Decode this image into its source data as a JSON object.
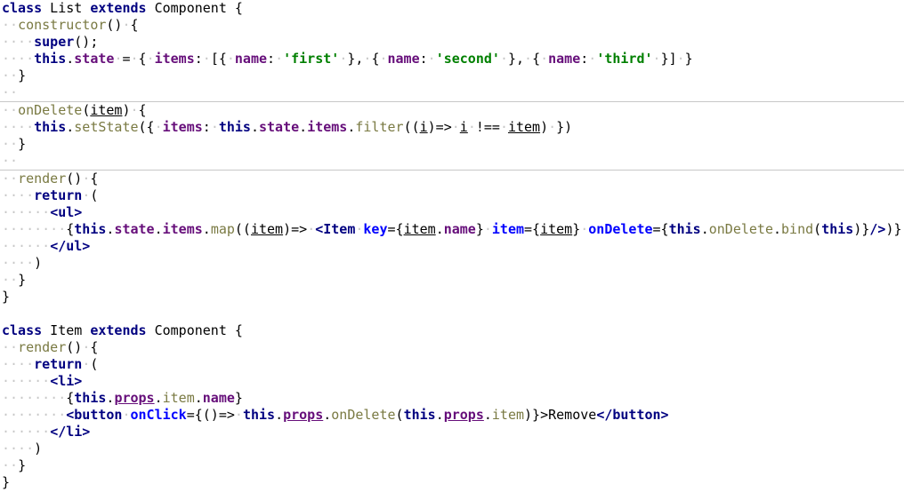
{
  "editor": {
    "lines": [
      "class List extends Component {",
      "  constructor() {",
      "    super();",
      "    this.state = { items: [{ name: 'first' }, { name: 'second' }, { name: 'third' }] }",
      "  }",
      "",
      "  onDelete(item) {",
      "    this.setState({ items: this.state.items.filter((i)=> i !== item) })",
      "  }",
      "",
      "  render() {",
      "    return (",
      "      <ul>",
      "        {this.state.items.map((item)=> <Item key={item.name} item={item} onDelete={this.onDelete.bind(this)}/>)}",
      "      </ul>",
      "    )",
      "  }",
      "}",
      "",
      "class Item extends Component {",
      "  render() {",
      "    return (",
      "      <li>",
      "        {this.props.item.name}",
      "        <button onClick={()=> this.props.onDelete(this.props.item)}>Remove</button>",
      "      </li>",
      "    )",
      "  }",
      "}"
    ]
  }
}
